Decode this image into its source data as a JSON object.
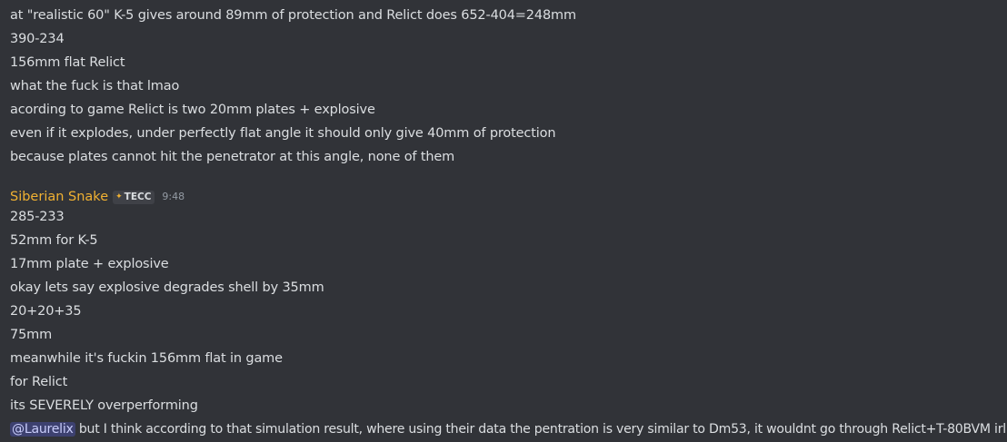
{
  "messages_group_1": [
    "at \"realistic 60\" K-5 gives around 89mm of protection and Relict does 652-404=248mm",
    "390-234",
    "156mm flat Relict",
    "what the fuck is that lmao",
    "acording to game Relict is two 20mm plates + explosive",
    "even if it explodes, under perfectly flat angle it should only give 40mm of protection",
    "because plates cannot hit the penetrator at this angle, none of them"
  ],
  "author": {
    "name": "Siberian Snake",
    "tag": "TECC",
    "tag_icon": "star-icon",
    "timestamp": "9:48",
    "name_color": "#f0b132"
  },
  "messages_group_2": [
    "285-233",
    "52mm for K-5",
    "17mm plate + explosive",
    "okay lets say explosive degrades shell by 35mm",
    "20+20+35",
    "75mm",
    "meanwhile it's fuckin 156mm flat in game",
    "for Relict",
    "its SEVERELY overperforming"
  ],
  "last_message": {
    "mention": "@Laurelix",
    "text": " but I think according to that simulation result, where using their data the pentration is very similar to Dm53, it wouldnt go through Relict+T-80BVM irl"
  },
  "colors": {
    "background": "#313338",
    "text": "#dbdee1",
    "timestamp": "#949ba4",
    "mention_bg": "rgba(88,101,242,0.3)"
  }
}
